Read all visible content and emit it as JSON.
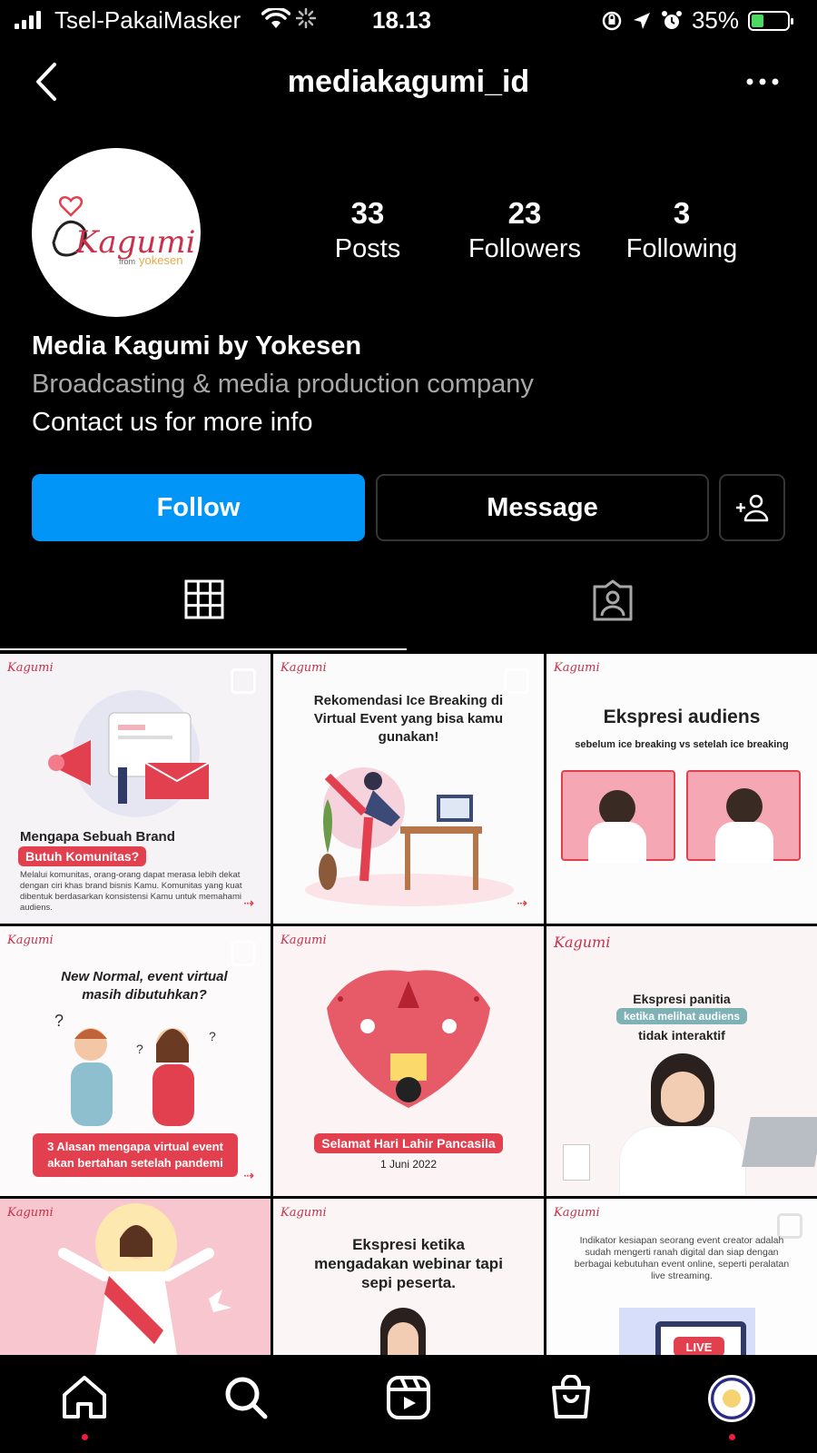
{
  "status_bar": {
    "carrier": "Tsel-PakaiMasker",
    "time": "18.13",
    "battery": "35%"
  },
  "header": {
    "username": "mediakagumi_id"
  },
  "profile": {
    "avatar_logo": "Kagumi",
    "avatar_sub": "from yokesen",
    "stats": [
      {
        "value": "33",
        "label": "Posts"
      },
      {
        "value": "23",
        "label": "Followers"
      },
      {
        "value": "3",
        "label": "Following"
      }
    ],
    "name": "Media Kagumi by Yokesen",
    "category": "Broadcasting & media production company",
    "bio": "Contact us for more info"
  },
  "actions": {
    "follow": "Follow",
    "message": "Message"
  },
  "posts": [
    {
      "title": "Mengapa Sebuah Brand",
      "tag": "Butuh Komunitas?",
      "body": "Melalui komunitas, orang-orang dapat merasa lebih dekat dengan ciri khas brand bisnis Kamu. Komunitas yang kuat dibentuk berdasarkan konsistensi Kamu untuk memahami audiens."
    },
    {
      "title": "Rekomendasi Ice Breaking di Virtual Event yang bisa kamu gunakan!"
    },
    {
      "title": "Ekspresi audiens",
      "subtitle": "sebelum ice breaking vs setelah ice breaking"
    },
    {
      "title": "New Normal, event virtual masih dibutuhkan?",
      "tag": "3 Alasan mengapa virtual event akan bertahan setelah pandemi"
    },
    {
      "tag": "Selamat Hari Lahir Pancasila",
      "subtitle": "1 Juni 2022"
    },
    {
      "title": "Ekspresi panitia",
      "tag": "ketika melihat audiens",
      "subtitle": "tidak interaktif"
    },
    {
      "title": ""
    },
    {
      "title": "Ekspresi ketika mengadakan webinar tapi sepi peserta."
    },
    {
      "body": "Indikator kesiapan seorang event creator adalah sudah mengerti ranah digital dan siap dengan berbagai kebutuhan event online, seperti peralatan live streaming.",
      "tag": "LIVE"
    }
  ],
  "tile_logo": "Kagumi",
  "icons": {
    "back": "chevron-left-icon",
    "more": "more-horizontal-icon",
    "add_person": "add-person-icon",
    "grid": "grid-icon",
    "tagged": "tagged-person-icon",
    "home": "home-icon",
    "search": "search-icon",
    "reels": "reels-icon",
    "shop": "shop-bag-icon",
    "profile": "profile-avatar-icon"
  },
  "colors": {
    "accent": "#0095f6",
    "brand": "#e2404e",
    "background": "#000000"
  }
}
